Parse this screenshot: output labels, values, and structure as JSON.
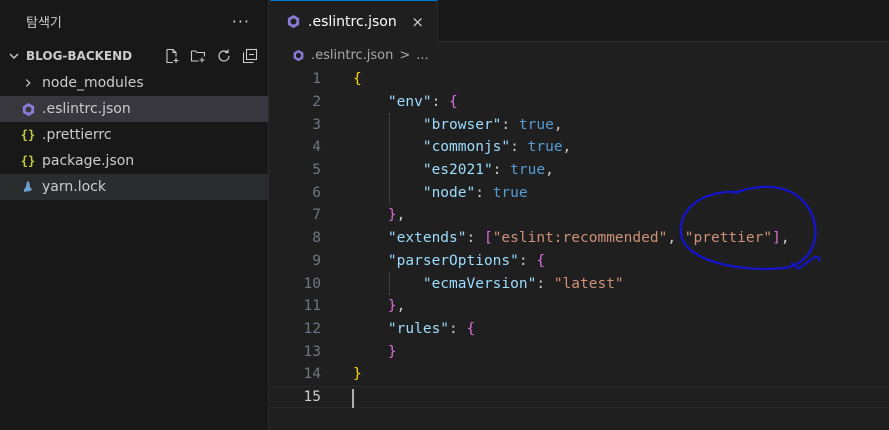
{
  "explorer": {
    "header": "탐색기",
    "more": "···",
    "section_title": "BLOG-BACKEND",
    "action_icons": [
      "new-file-icon",
      "new-folder-icon",
      "refresh-icon",
      "collapse-all-icon"
    ],
    "items": [
      {
        "label": "node_modules",
        "icon": "chevron-right-icon",
        "type": "folder"
      },
      {
        "label": ".eslintrc.json",
        "icon": "eslint-icon",
        "type": "file",
        "selected": true
      },
      {
        "label": ".prettierrc",
        "icon": "json-icon",
        "type": "file"
      },
      {
        "label": "package.json",
        "icon": "json-icon",
        "type": "file"
      },
      {
        "label": "yarn.lock",
        "icon": "yarn-icon",
        "type": "file",
        "hover": true
      }
    ]
  },
  "tab": {
    "label": ".eslintrc.json",
    "close": "×"
  },
  "breadcrumb": {
    "file": ".eslintrc.json",
    "sep": ">",
    "more": "..."
  },
  "editor": {
    "active_line": 15,
    "lines": [
      {
        "n": "1",
        "tokens": [
          {
            "c": "br1",
            "t": "{"
          }
        ]
      },
      {
        "n": "2",
        "tokens": [
          {
            "c": "p",
            "t": "    "
          },
          {
            "c": "k",
            "t": "\"env\""
          },
          {
            "c": "p",
            "t": ": "
          },
          {
            "c": "br2",
            "t": "{"
          }
        ]
      },
      {
        "n": "3",
        "tokens": [
          {
            "c": "p",
            "t": "        "
          },
          {
            "c": "k",
            "t": "\"browser\""
          },
          {
            "c": "p",
            "t": ": "
          },
          {
            "c": "b",
            "t": "true"
          },
          {
            "c": "p",
            "t": ","
          }
        ]
      },
      {
        "n": "4",
        "tokens": [
          {
            "c": "p",
            "t": "        "
          },
          {
            "c": "k",
            "t": "\"commonjs\""
          },
          {
            "c": "p",
            "t": ": "
          },
          {
            "c": "b",
            "t": "true"
          },
          {
            "c": "p",
            "t": ","
          }
        ]
      },
      {
        "n": "5",
        "tokens": [
          {
            "c": "p",
            "t": "        "
          },
          {
            "c": "k",
            "t": "\"es2021\""
          },
          {
            "c": "p",
            "t": ": "
          },
          {
            "c": "b",
            "t": "true"
          },
          {
            "c": "p",
            "t": ","
          }
        ]
      },
      {
        "n": "6",
        "tokens": [
          {
            "c": "p",
            "t": "        "
          },
          {
            "c": "k",
            "t": "\"node\""
          },
          {
            "c": "p",
            "t": ": "
          },
          {
            "c": "b",
            "t": "true"
          }
        ]
      },
      {
        "n": "7",
        "tokens": [
          {
            "c": "p",
            "t": "    "
          },
          {
            "c": "br2",
            "t": "}"
          },
          {
            "c": "p",
            "t": ","
          }
        ]
      },
      {
        "n": "8",
        "tokens": [
          {
            "c": "p",
            "t": "    "
          },
          {
            "c": "k",
            "t": "\"extends\""
          },
          {
            "c": "p",
            "t": ": "
          },
          {
            "c": "br2",
            "t": "["
          },
          {
            "c": "s",
            "t": "\"eslint:recommended\""
          },
          {
            "c": "p",
            "t": ", "
          },
          {
            "c": "s",
            "t": "\"prettier\""
          },
          {
            "c": "br2",
            "t": "]"
          },
          {
            "c": "p",
            "t": ","
          }
        ]
      },
      {
        "n": "9",
        "tokens": [
          {
            "c": "p",
            "t": "    "
          },
          {
            "c": "k",
            "t": "\"parserOptions\""
          },
          {
            "c": "p",
            "t": ": "
          },
          {
            "c": "br2",
            "t": "{"
          }
        ]
      },
      {
        "n": "10",
        "tokens": [
          {
            "c": "p",
            "t": "        "
          },
          {
            "c": "k",
            "t": "\"ecmaVersion\""
          },
          {
            "c": "p",
            "t": ": "
          },
          {
            "c": "s",
            "t": "\"latest\""
          }
        ]
      },
      {
        "n": "11",
        "tokens": [
          {
            "c": "p",
            "t": "    "
          },
          {
            "c": "br2",
            "t": "}"
          },
          {
            "c": "p",
            "t": ","
          }
        ]
      },
      {
        "n": "12",
        "tokens": [
          {
            "c": "p",
            "t": "    "
          },
          {
            "c": "k",
            "t": "\"rules\""
          },
          {
            "c": "p",
            "t": ": "
          },
          {
            "c": "br2",
            "t": "{"
          }
        ]
      },
      {
        "n": "13",
        "tokens": [
          {
            "c": "p",
            "t": "    "
          },
          {
            "c": "br2",
            "t": "}"
          }
        ]
      },
      {
        "n": "14",
        "tokens": [
          {
            "c": "br1",
            "t": "}"
          }
        ]
      },
      {
        "n": "15",
        "tokens": []
      }
    ]
  },
  "colors": {
    "accent": "#0078d4",
    "annotation": "#1414c8",
    "eslint": "#8b7bd8",
    "json": "#cbcb41"
  }
}
